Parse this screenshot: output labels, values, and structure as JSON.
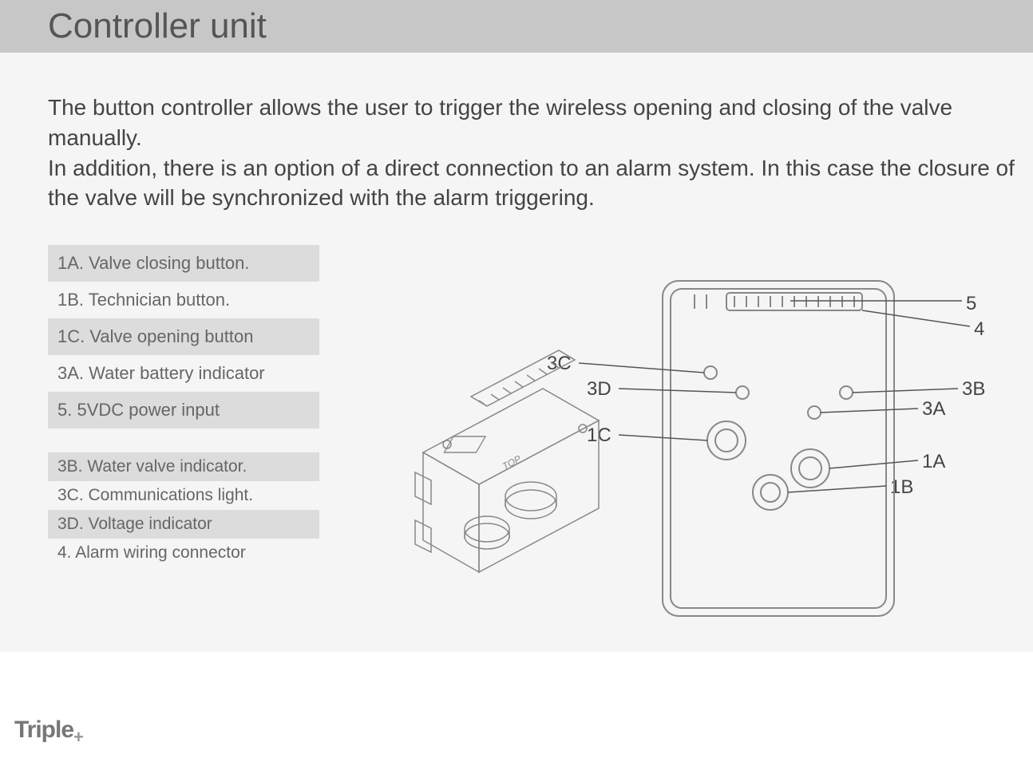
{
  "title": "Controller unit",
  "intro": "The button controller allows the user to trigger the wireless opening and closing of the valve manually.\nIn addition, there is an option of a direct connection to an alarm system. In this case the closure of the valve will be synchronized with the alarm triggering.",
  "table1": [
    "1A. Valve closing button.",
    "1B. Technician button.",
    "1C. Valve opening button",
    "3A. Water battery indicator",
    "5. 5VDC power input"
  ],
  "table2": [
    "3B. Water valve indicator.",
    "3C. Communications light.",
    "3D. Voltage indicator",
    "4. Alarm wiring connector"
  ],
  "callouts": {
    "c5": "5",
    "c4": "4",
    "c3c": "3C",
    "c3d": "3D",
    "c3b": "3B",
    "c3a": "3A",
    "c1c": "1C",
    "c1a": "1A",
    "c1b": "1B"
  },
  "brand": "Triple",
  "brand_plus": "+"
}
